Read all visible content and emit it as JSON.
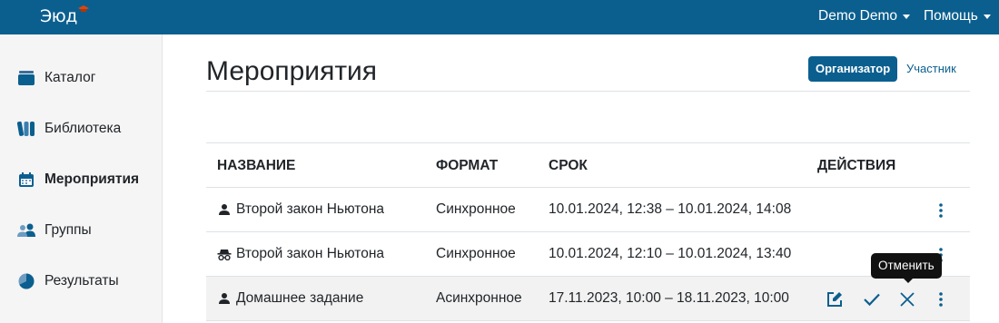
{
  "app": {
    "logo_text": "Эюд"
  },
  "topbar": {
    "user_menu": "Demo Demo",
    "help_menu": "Помощь"
  },
  "sidebar": {
    "items": [
      {
        "label": "Каталог",
        "icon": "catalog-icon",
        "active": false
      },
      {
        "label": "Библиотека",
        "icon": "library-icon",
        "active": false
      },
      {
        "label": "Мероприятия",
        "icon": "calendar-icon",
        "active": true
      },
      {
        "label": "Группы",
        "icon": "users-icon",
        "active": false
      },
      {
        "label": "Результаты",
        "icon": "pie-chart-icon",
        "active": false
      }
    ]
  },
  "main": {
    "title": "Мероприятия",
    "role_toggle": {
      "organizer": "Организатор",
      "participant": "Участник",
      "selected": "Организатор"
    }
  },
  "table": {
    "columns": [
      "НАЗВАНИЕ",
      "ФОРМАТ",
      "СРОК",
      "ДЕЙСТВИЯ"
    ],
    "rows": [
      {
        "icon": "person-icon",
        "name": "Второй закон Ньютона",
        "format": "Синхронное",
        "period": "10.01.2024, 12:38 – 10.01.2024, 14:08"
      },
      {
        "icon": "incognito-icon",
        "name": "Второй закон Ньютона",
        "format": "Синхронное",
        "period": "10.01.2024, 12:10 – 10.01.2024, 13:40"
      },
      {
        "icon": "person-icon",
        "name": "Домашнее задание",
        "format": "Асинхронное",
        "period": "17.11.2023, 10:00 – 18.11.2023, 10:00"
      }
    ]
  },
  "tooltip": {
    "text": "Отменить"
  },
  "colors": {
    "primary": "#0b5f8f",
    "sidebar_bg": "#f5f5f5",
    "tooltip_bg": "#111111"
  }
}
